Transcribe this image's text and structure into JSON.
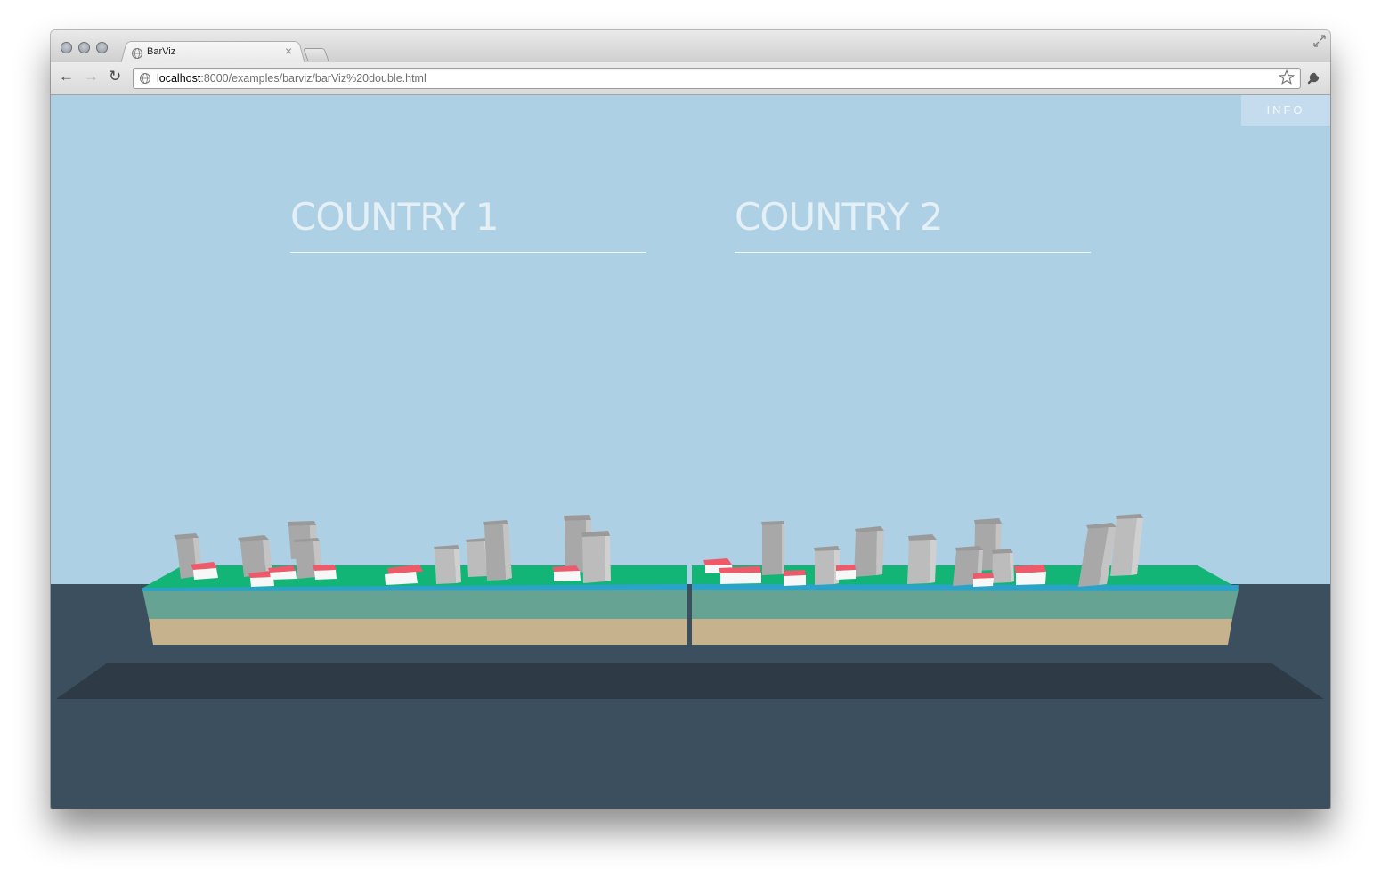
{
  "browser": {
    "tab_title": "BarViz",
    "url_host": "localhost",
    "url_rest": ":8000/examples/barviz/barViz%20double.html"
  },
  "page": {
    "info_label": "INFO",
    "country_titles": [
      "COUNTRY 1",
      "COUNTRY 2"
    ]
  },
  "scene": {
    "colors": {
      "sky": "#add0e4",
      "floor": "#3c4f5e",
      "floor_shadow": "#2e3b46",
      "grass": "#13b576",
      "water": "#2ba3c8",
      "soil": "#67a393",
      "sand": "#c6b38e",
      "tower": "#b3b3b3",
      "house_roof": "#ee5a6a"
    },
    "icons": [
      "globe-icon",
      "close-icon",
      "back-arrow-icon",
      "forward-arrow-icon",
      "reload-icon",
      "star-icon",
      "wrench-icon"
    ]
  }
}
